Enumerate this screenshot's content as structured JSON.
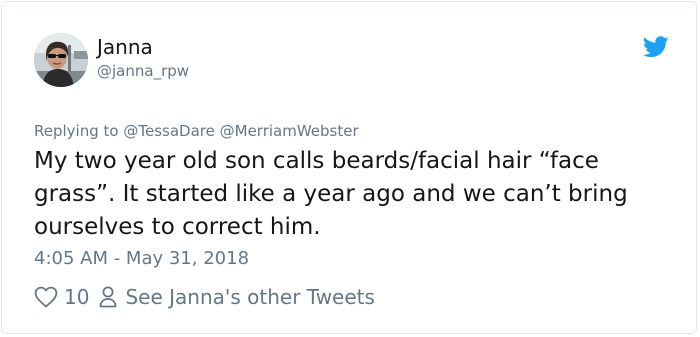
{
  "author": {
    "display_name": "Janna",
    "handle": "@janna_rpw"
  },
  "reply": {
    "prefix": "Replying to",
    "mentions": [
      "@TessaDare",
      "@MerriamWebster"
    ]
  },
  "tweet": {
    "text": "My two year old son calls beards/facial hair “face grass”. It started like a year ago and we can’t bring ourselves to correct him.",
    "timestamp": "4:05 AM - May 31, 2018"
  },
  "actions": {
    "like_count": "10",
    "profile_link": "See Janna's other Tweets"
  },
  "colors": {
    "twitter_blue": "#1da1f2",
    "muted_text": "#657786",
    "main_text": "#14171a",
    "border": "#e1e8ed"
  },
  "icons": {
    "brand": "twitter-bird-icon",
    "like": "heart-outline-icon",
    "profile": "person-outline-icon"
  }
}
